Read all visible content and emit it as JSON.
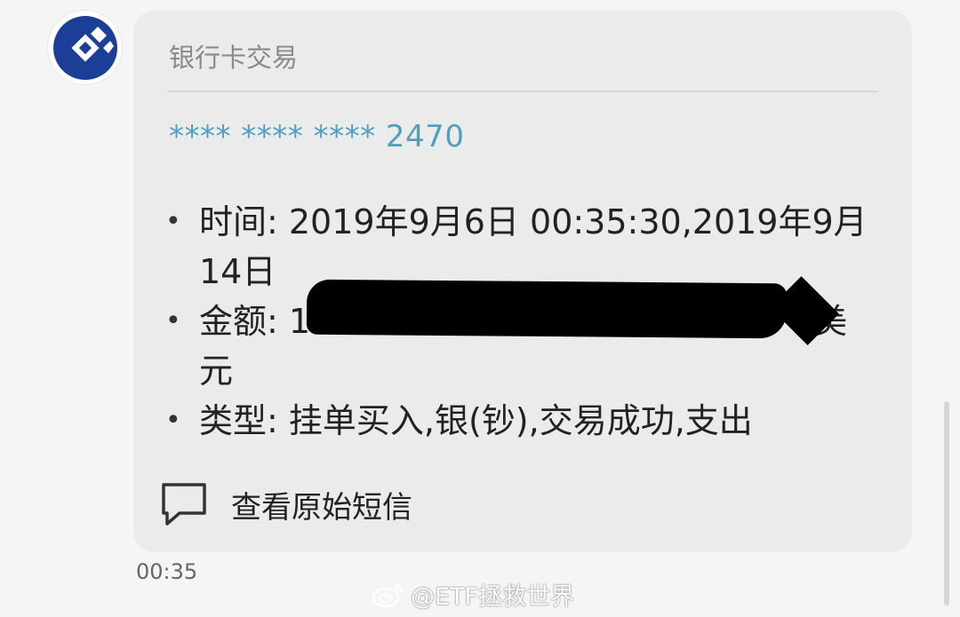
{
  "sender": {
    "logo_icon": "ccb-bank-logo-icon",
    "brand_color": "#1b3f96"
  },
  "card": {
    "title": "银行卡交易",
    "card_number": "**** **** **** 2470",
    "number_color": "#4f9fbf",
    "details": [
      {
        "text": "时间: 2019年9月6日 00:35:30,2019年9月14日"
      },
      {
        "text": "金额: 1",
        "suffix": "美元"
      },
      {
        "text": "类型: 挂单买入,银(钞),交易成功,支出"
      }
    ],
    "view_original_icon": "message-bubble-icon",
    "view_original_label": "查看原始短信"
  },
  "timestamp": "00:35",
  "watermark": {
    "icon": "weibo-icon",
    "text": "@ETF拯救世界"
  }
}
